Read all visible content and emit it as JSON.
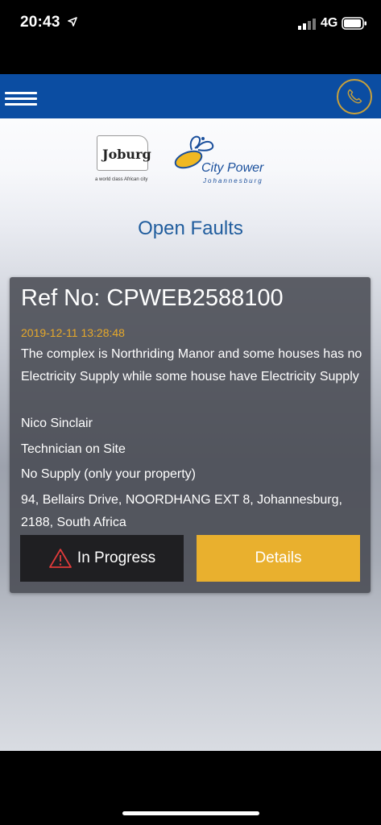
{
  "status_bar": {
    "time": "20:43",
    "network": "4G"
  },
  "header": {
    "menu_icon": "hamburger-menu-icon",
    "call_icon": "phone-icon"
  },
  "logos": {
    "joburg_text": "Joburg",
    "joburg_tagline": "a world class African city",
    "citypower_name": "City Power",
    "citypower_city": "Johannesburg"
  },
  "page": {
    "title": "Open Faults"
  },
  "fault": {
    "ref_no": "Ref No: CPWEB2588100",
    "date": "2019-12-11 13:28:48",
    "description": "The complex is Northriding Manor and some houses has no Electricity Supply while some house have Electricity Supply",
    "name": "Nico Sinclair",
    "status_text": "Technician on Site",
    "fault_type": "No Supply (only your property)",
    "address": "94, Bellairs Drive, NOORDHANG EXT 8, Johannesburg, 2188, South Africa",
    "status_button_label": "In Progress",
    "details_button_label": "Details"
  },
  "colors": {
    "header_bg": "#0b4da2",
    "accent_gold": "#e9b02e",
    "title_blue": "#1f5c9d",
    "warning_red": "#e03a3a"
  }
}
